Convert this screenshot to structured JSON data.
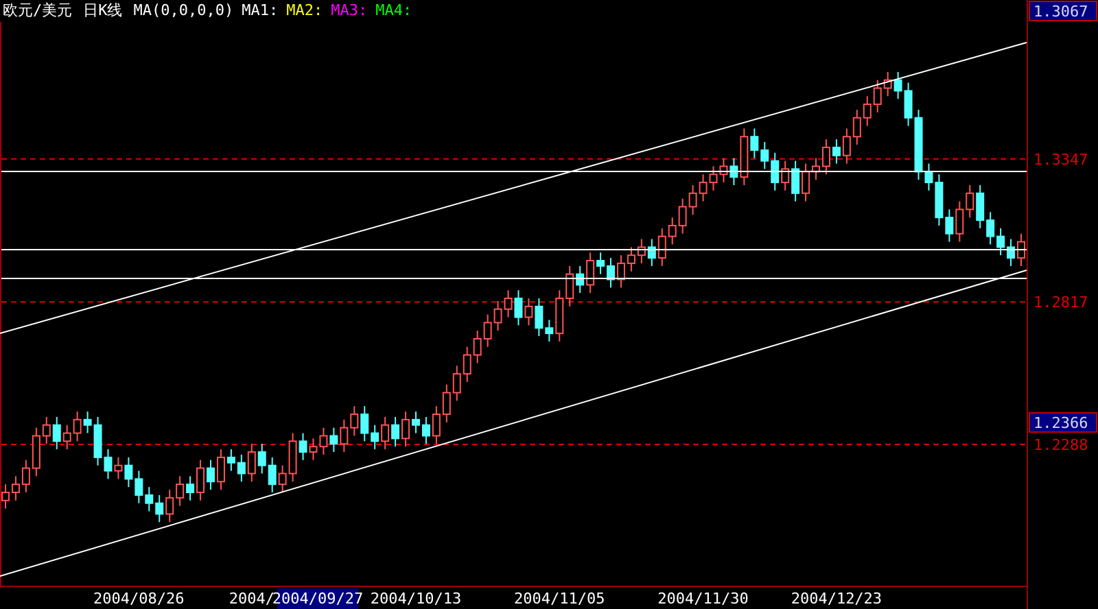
{
  "header": {
    "symbol": "欧元/美元",
    "period": "日K线",
    "ma_params": "MA(0,0,0,0)",
    "ma_lines": [
      {
        "label": "MA1:",
        "color": "#ffffff"
      },
      {
        "label": "MA2:",
        "color": "#ffff00"
      },
      {
        "label": "MA3:",
        "color": "#ff00ff"
      },
      {
        "label": "MA4:",
        "color": "#00ff00"
      }
    ]
  },
  "top_price": "1.3067",
  "cursor_price": "1.2366",
  "cursor_date": "2004/09/27",
  "chart_data": {
    "type": "candlestick",
    "grid": true,
    "ylim": [
      1.1769,
      1.3937
    ],
    "yticks": [
      {
        "value": 1.2288,
        "label": "1.2288"
      },
      {
        "value": 1.2817,
        "label": "1.2817"
      },
      {
        "value": 1.3347,
        "label": "1.3347"
      }
    ],
    "categories": [
      null,
      null,
      null,
      null,
      null,
      null,
      null,
      null,
      null,
      null,
      null,
      null,
      null,
      "2004/08/26",
      null,
      null,
      null,
      null,
      null,
      null,
      null,
      null,
      null,
      null,
      "2004/",
      null,
      null,
      null,
      null,
      null,
      null,
      null,
      null,
      null,
      null,
      null,
      null,
      null,
      null,
      null,
      "2004/10/13",
      null,
      null,
      null,
      null,
      null,
      null,
      null,
      null,
      null,
      null,
      null,
      null,
      null,
      "2004/11/05",
      null,
      null,
      null,
      null,
      null,
      null,
      null,
      null,
      null,
      null,
      null,
      null,
      null,
      "2004/11/30",
      null,
      null,
      null,
      null,
      null,
      null,
      null,
      null,
      null,
      null,
      null,
      null,
      "2004/12/23",
      null,
      null,
      null,
      null,
      null,
      null,
      null,
      null,
      null,
      null,
      null,
      null,
      null,
      null,
      null,
      null,
      null,
      null
    ],
    "ohlc": [
      [
        1.208,
        1.214,
        1.205,
        1.211
      ],
      [
        1.211,
        1.217,
        1.208,
        1.214
      ],
      [
        1.214,
        1.223,
        1.211,
        1.22
      ],
      [
        1.22,
        1.235,
        1.217,
        1.232
      ],
      [
        1.232,
        1.239,
        1.229,
        1.236
      ],
      [
        1.236,
        1.239,
        1.227,
        1.23
      ],
      [
        1.23,
        1.236,
        1.227,
        1.233
      ],
      [
        1.233,
        1.241,
        1.23,
        1.238
      ],
      [
        1.238,
        1.241,
        1.233,
        1.236
      ],
      [
        1.236,
        1.239,
        1.221,
        1.224
      ],
      [
        1.224,
        1.227,
        1.216,
        1.219
      ],
      [
        1.219,
        1.224,
        1.216,
        1.221
      ],
      [
        1.221,
        1.224,
        1.213,
        1.216
      ],
      [
        1.216,
        1.219,
        1.207,
        1.21
      ],
      [
        1.21,
        1.213,
        1.204,
        1.207
      ],
      [
        1.207,
        1.21,
        1.2,
        1.203
      ],
      [
        1.203,
        1.212,
        1.2,
        1.209
      ],
      [
        1.209,
        1.217,
        1.206,
        1.214
      ],
      [
        1.214,
        1.217,
        1.208,
        1.211
      ],
      [
        1.211,
        1.223,
        1.208,
        1.22
      ],
      [
        1.22,
        1.223,
        1.212,
        1.215
      ],
      [
        1.215,
        1.227,
        1.212,
        1.224
      ],
      [
        1.224,
        1.227,
        1.219,
        1.222
      ],
      [
        1.222,
        1.225,
        1.215,
        1.218
      ],
      [
        1.218,
        1.229,
        1.215,
        1.226
      ],
      [
        1.226,
        1.229,
        1.218,
        1.221
      ],
      [
        1.221,
        1.224,
        1.211,
        1.214
      ],
      [
        1.214,
        1.221,
        1.211,
        1.218
      ],
      [
        1.218,
        1.233,
        1.215,
        1.23
      ],
      [
        1.23,
        1.233,
        1.223,
        1.226
      ],
      [
        1.226,
        1.231,
        1.223,
        1.228
      ],
      [
        1.228,
        1.235,
        1.225,
        1.232
      ],
      [
        1.232,
        1.235,
        1.226,
        1.229
      ],
      [
        1.229,
        1.238,
        1.226,
        1.235
      ],
      [
        1.235,
        1.243,
        1.232,
        1.24
      ],
      [
        1.24,
        1.243,
        1.23,
        1.233
      ],
      [
        1.233,
        1.236,
        1.227,
        1.23
      ],
      [
        1.23,
        1.239,
        1.227,
        1.236
      ],
      [
        1.236,
        1.239,
        1.228,
        1.231
      ],
      [
        1.231,
        1.241,
        1.228,
        1.238
      ],
      [
        1.238,
        1.241,
        1.233,
        1.236
      ],
      [
        1.236,
        1.239,
        1.229,
        1.232
      ],
      [
        1.232,
        1.243,
        1.229,
        1.24
      ],
      [
        1.24,
        1.251,
        1.237,
        1.248
      ],
      [
        1.248,
        1.258,
        1.245,
        1.255
      ],
      [
        1.255,
        1.265,
        1.252,
        1.262
      ],
      [
        1.262,
        1.271,
        1.259,
        1.268
      ],
      [
        1.268,
        1.277,
        1.265,
        1.274
      ],
      [
        1.274,
        1.282,
        1.271,
        1.279
      ],
      [
        1.279,
        1.286,
        1.276,
        1.283
      ],
      [
        1.283,
        1.286,
        1.273,
        1.276
      ],
      [
        1.276,
        1.283,
        1.273,
        1.28
      ],
      [
        1.28,
        1.283,
        1.269,
        1.272
      ],
      [
        1.272,
        1.275,
        1.267,
        1.27
      ],
      [
        1.27,
        1.286,
        1.267,
        1.283
      ],
      [
        1.283,
        1.295,
        1.28,
        1.292
      ],
      [
        1.292,
        1.295,
        1.285,
        1.288
      ],
      [
        1.288,
        1.3,
        1.285,
        1.297
      ],
      [
        1.297,
        1.3,
        1.292,
        1.295
      ],
      [
        1.295,
        1.298,
        1.287,
        1.29
      ],
      [
        1.29,
        1.299,
        1.287,
        1.296
      ],
      [
        1.296,
        1.302,
        1.293,
        1.299
      ],
      [
        1.299,
        1.305,
        1.296,
        1.302
      ],
      [
        1.302,
        1.305,
        1.295,
        1.298
      ],
      [
        1.298,
        1.309,
        1.295,
        1.306
      ],
      [
        1.306,
        1.313,
        1.303,
        1.31
      ],
      [
        1.31,
        1.32,
        1.307,
        1.317
      ],
      [
        1.317,
        1.325,
        1.314,
        1.322
      ],
      [
        1.322,
        1.329,
        1.319,
        1.326
      ],
      [
        1.326,
        1.332,
        1.323,
        1.329
      ],
      [
        1.329,
        1.335,
        1.326,
        1.332
      ],
      [
        1.332,
        1.335,
        1.325,
        1.328
      ],
      [
        1.328,
        1.346,
        1.325,
        1.343
      ],
      [
        1.343,
        1.346,
        1.335,
        1.338
      ],
      [
        1.338,
        1.341,
        1.331,
        1.334
      ],
      [
        1.334,
        1.337,
        1.323,
        1.326
      ],
      [
        1.326,
        1.334,
        1.323,
        1.331
      ],
      [
        1.331,
        1.334,
        1.319,
        1.322
      ],
      [
        1.322,
        1.333,
        1.319,
        1.33
      ],
      [
        1.33,
        1.335,
        1.327,
        1.332
      ],
      [
        1.332,
        1.342,
        1.329,
        1.339
      ],
      [
        1.339,
        1.342,
        1.333,
        1.336
      ],
      [
        1.336,
        1.346,
        1.333,
        1.343
      ],
      [
        1.343,
        1.353,
        1.34,
        1.35
      ],
      [
        1.35,
        1.358,
        1.347,
        1.355
      ],
      [
        1.355,
        1.364,
        1.352,
        1.361
      ],
      [
        1.361,
        1.367,
        1.358,
        1.364
      ],
      [
        1.364,
        1.367,
        1.357,
        1.36
      ],
      [
        1.36,
        1.363,
        1.347,
        1.35
      ],
      [
        1.35,
        1.353,
        1.327,
        1.33
      ],
      [
        1.33,
        1.333,
        1.323,
        1.326
      ],
      [
        1.326,
        1.329,
        1.31,
        1.313
      ],
      [
        1.313,
        1.316,
        1.304,
        1.307
      ],
      [
        1.307,
        1.319,
        1.304,
        1.316
      ],
      [
        1.316,
        1.325,
        1.313,
        1.322
      ],
      [
        1.322,
        1.325,
        1.309,
        1.312
      ],
      [
        1.312,
        1.315,
        1.303,
        1.306
      ],
      [
        1.306,
        1.309,
        1.299,
        1.302
      ],
      [
        1.302,
        1.305,
        1.295,
        1.298
      ],
      [
        1.298,
        1.307,
        1.295,
        1.304
      ]
    ]
  }
}
